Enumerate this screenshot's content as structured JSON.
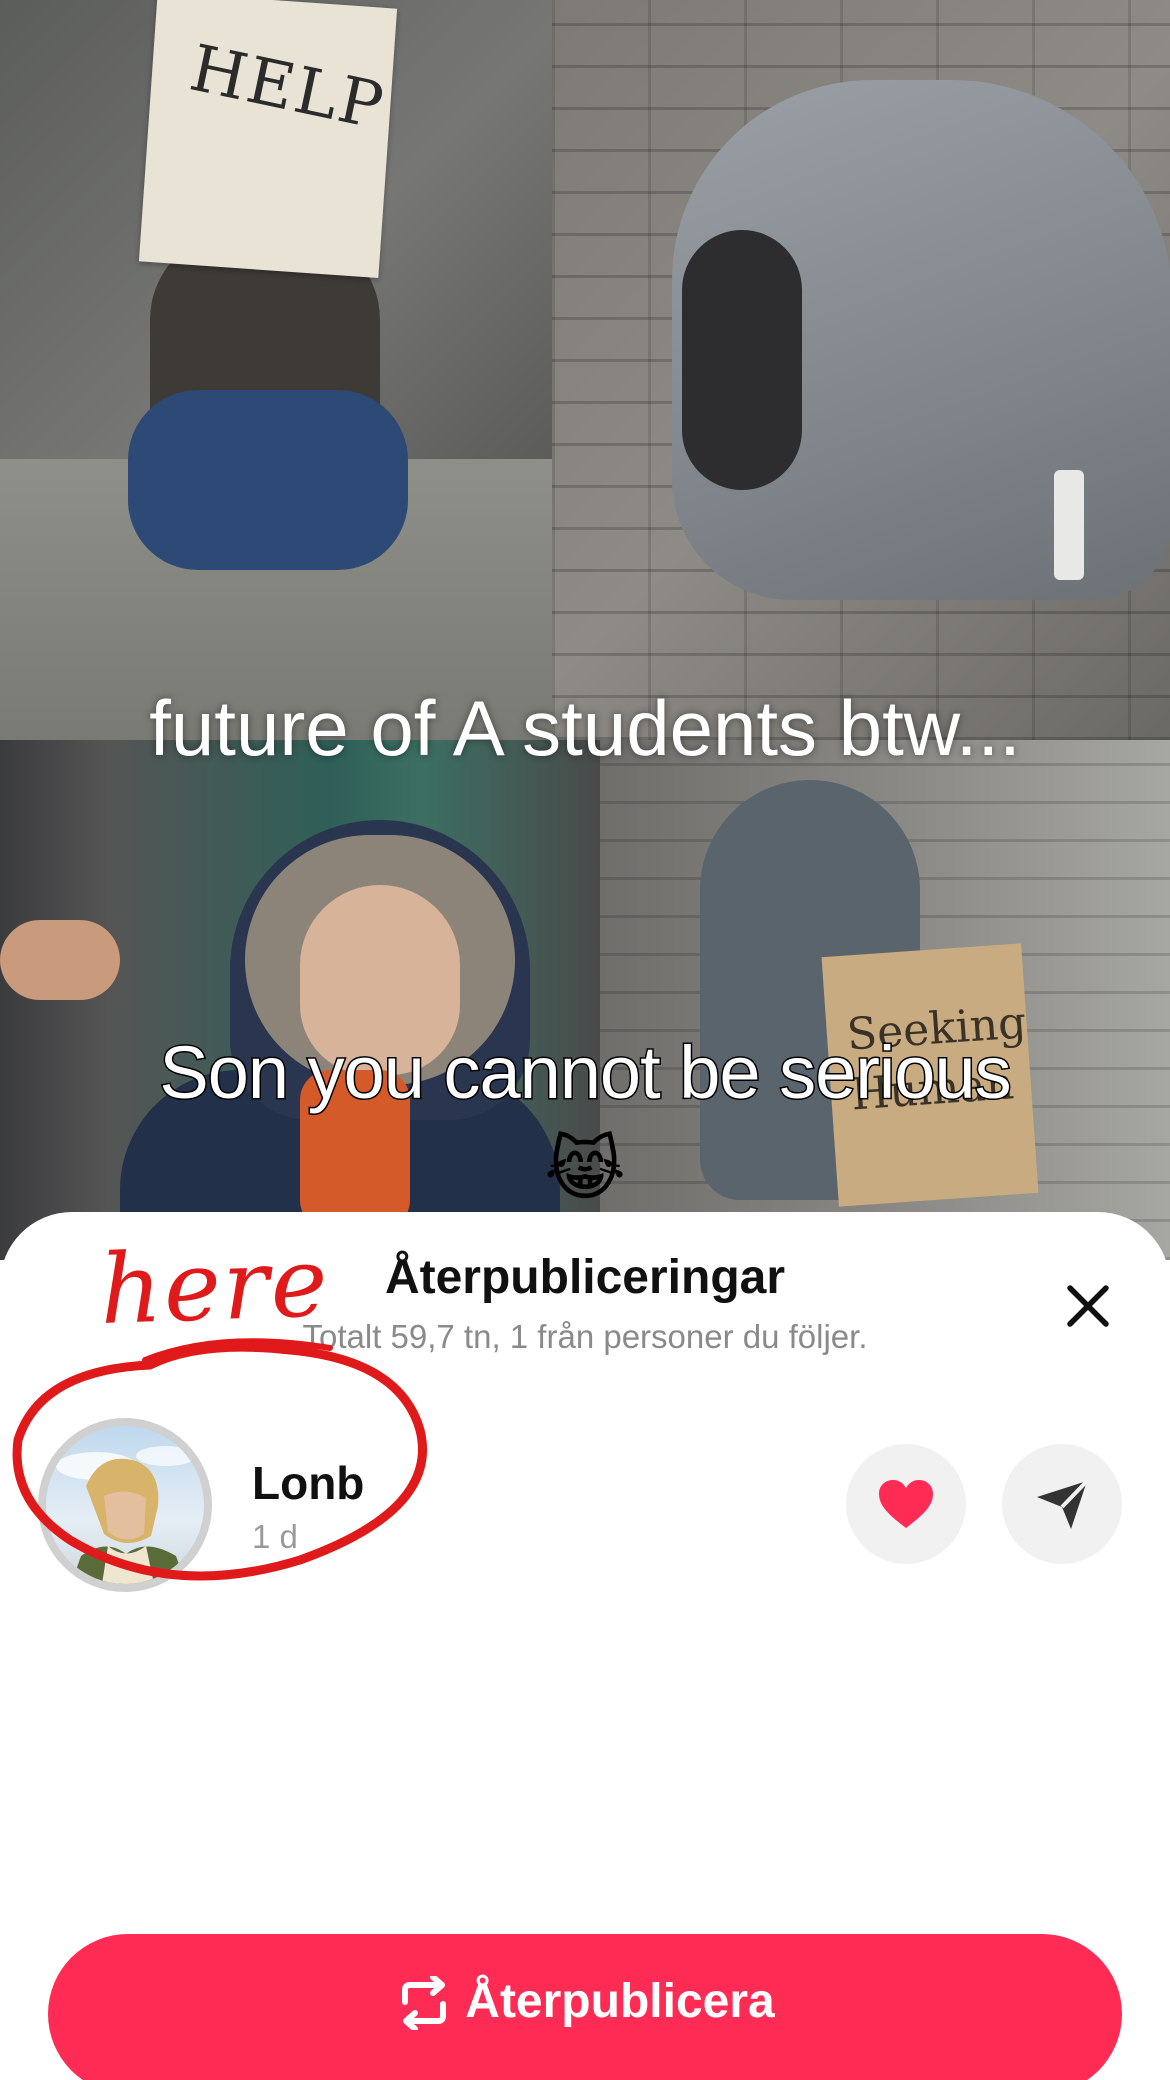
{
  "video": {
    "overlay_text": "future of A students btw...",
    "caption": "Son you cannot be serious",
    "caption_emoji": "😹",
    "sign_help": "HELP",
    "sign_seeking": "Seeking Human"
  },
  "sheet": {
    "title": "Återpubliceringar",
    "subtitle": "Totalt 59,7 tn, 1 från personer du följer.",
    "close_icon": "close-icon"
  },
  "reposts": [
    {
      "username": "Lonb",
      "time": "1 d",
      "like_icon": "heart-icon",
      "send_icon": "send-icon"
    }
  ],
  "annotation": {
    "text": "here",
    "color": "#e01a1a"
  },
  "repost_button": {
    "label": "Återpublicera",
    "icon": "repost-icon",
    "color": "#fe2c55"
  }
}
